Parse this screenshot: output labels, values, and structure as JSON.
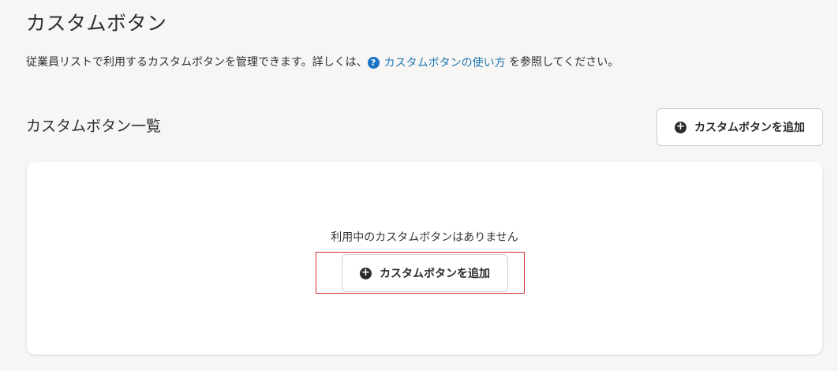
{
  "page": {
    "title": "カスタムボタン",
    "description_before": "従業員リストで利用するカスタムボタンを管理できます。詳しくは、",
    "help_link_label": "カスタムボタンの使い方",
    "description_after": " を参照してください。"
  },
  "section": {
    "title": "カスタムボタン一覧",
    "add_button_label": "カスタムボタンを追加"
  },
  "empty_state": {
    "message": "利用中のカスタムボタンはありません",
    "add_button_label": "カスタムボタンを追加",
    "highlight_color": "#d32f2f"
  },
  "icons": {
    "help": "question-circle-icon",
    "add": "plus-circle-icon"
  },
  "colors": {
    "link": "#1f77b4",
    "background": "#f7f6f4"
  }
}
